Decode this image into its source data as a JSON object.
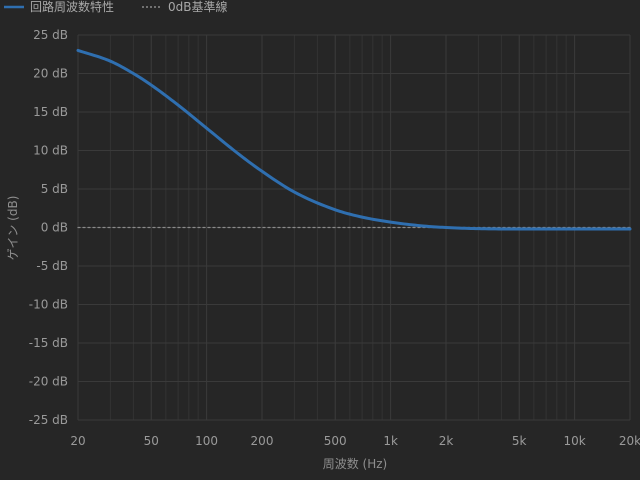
{
  "chart_data": {
    "type": "line",
    "title": "",
    "xlabel": "周波数 (Hz)",
    "ylabel": "ゲイン (dB)",
    "x_scale": "log",
    "xlim": [
      20,
      20000
    ],
    "ylim": [
      -25,
      25
    ],
    "x_ticks": [
      {
        "value": 20,
        "label": "20"
      },
      {
        "value": 50,
        "label": "50"
      },
      {
        "value": 100,
        "label": "100"
      },
      {
        "value": 200,
        "label": "200"
      },
      {
        "value": 500,
        "label": "500"
      },
      {
        "value": 1000,
        "label": "1k"
      },
      {
        "value": 2000,
        "label": "2k"
      },
      {
        "value": 5000,
        "label": "5k"
      },
      {
        "value": 10000,
        "label": "10k"
      },
      {
        "value": 20000,
        "label": "20k"
      }
    ],
    "y_ticks": [
      {
        "value": 25,
        "label": "25 dB"
      },
      {
        "value": 20,
        "label": "20 dB"
      },
      {
        "value": 15,
        "label": "15 dB"
      },
      {
        "value": 10,
        "label": "10 dB"
      },
      {
        "value": 5,
        "label": "5 dB"
      },
      {
        "value": 0,
        "label": "0 dB"
      },
      {
        "value": -5,
        "label": "-5 dB"
      },
      {
        "value": -10,
        "label": "-10 dB"
      },
      {
        "value": -15,
        "label": "-15 dB"
      },
      {
        "value": -20,
        "label": "-20 dB"
      },
      {
        "value": -25,
        "label": "-25 dB"
      }
    ],
    "grid": true,
    "legend_position": "top-left",
    "series": [
      {
        "name": "回路周波数特性",
        "color": "#2f6fb0",
        "style": "solid",
        "x": [
          20,
          30,
          40,
          50,
          70,
          100,
          150,
          200,
          300,
          500,
          700,
          1000,
          1500,
          2000,
          3000,
          5000,
          10000,
          20000
        ],
        "y": [
          23,
          21.6,
          20,
          18.5,
          15.9,
          12.9,
          9.5,
          7.3,
          4.6,
          2.3,
          1.35,
          0.7,
          0.2,
          0.0,
          -0.15,
          -0.2,
          -0.2,
          -0.2
        ]
      },
      {
        "name": "0dB基準線",
        "color": "#8a8a8a",
        "style": "dotted",
        "x": [
          20,
          20000
        ],
        "y": [
          0,
          0
        ]
      }
    ]
  }
}
